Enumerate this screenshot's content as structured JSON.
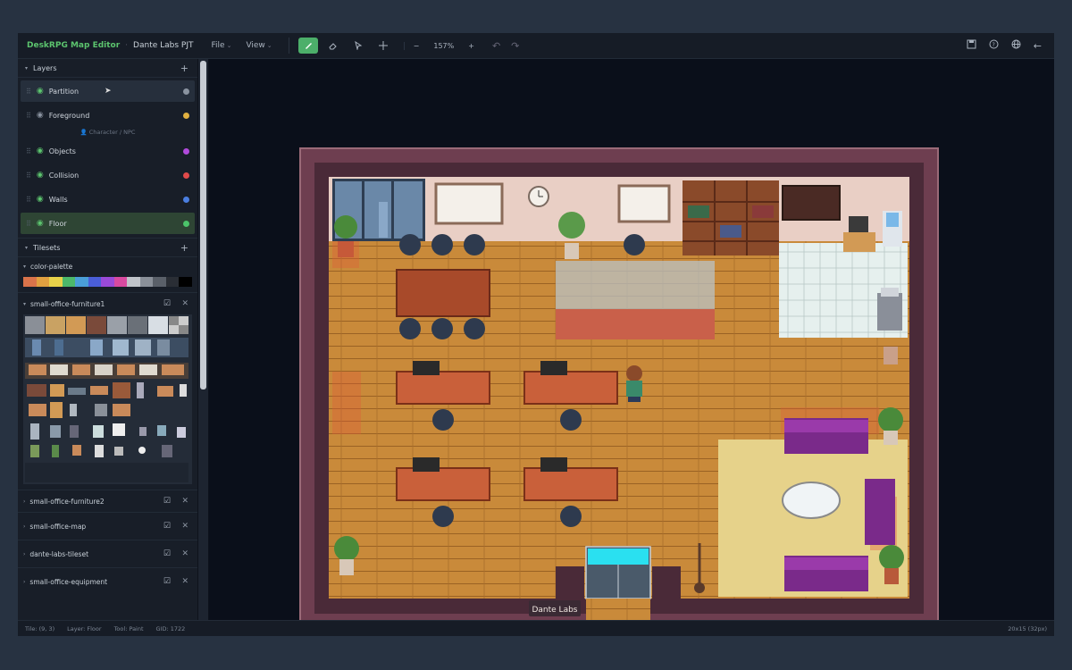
{
  "app": {
    "title": "DeskRPG Map Editor",
    "separator": "·",
    "project": "Dante Labs PJT"
  },
  "menu": {
    "file": "File",
    "view": "View"
  },
  "toolbar": {
    "tools": [
      "paint-brush",
      "eraser",
      "select-arrow",
      "move"
    ],
    "active_tool": "paint-brush",
    "zoom": "157%",
    "zoom_out": "−",
    "zoom_in": "+"
  },
  "layers": {
    "title": "Layers",
    "items": [
      {
        "name": "Partition",
        "color": "#8a93a0"
      },
      {
        "name": "Foreground",
        "color": "#e0b040"
      },
      {
        "name": "Objects",
        "color": "#b04adb"
      },
      {
        "name": "Collision",
        "color": "#e04a4a"
      },
      {
        "name": "Walls",
        "color": "#4a7ee0"
      },
      {
        "name": "Floor",
        "color": "#4cc46a"
      }
    ],
    "note": "Character / NPC"
  },
  "tilesets": {
    "title": "Tilesets",
    "palette_name": "color-palette",
    "palette": [
      "#d9734a",
      "#e0a040",
      "#e8d24a",
      "#4cb86a",
      "#4a9ed8",
      "#4a5ed8",
      "#9a4ad8",
      "#d84aa0",
      "#c0c4ca",
      "#8a9099",
      "#5a6069",
      "#2a2e35",
      "#000000"
    ],
    "items": [
      {
        "name": "small-office-furniture1",
        "expanded": true
      },
      {
        "name": "small-office-furniture2"
      },
      {
        "name": "small-office-map"
      },
      {
        "name": "dante-labs-tileset"
      },
      {
        "name": "small-office-equipment"
      }
    ]
  },
  "map": {
    "entrance_label": "Dante Labs"
  },
  "status": {
    "tile": "Tile: (9, 3)",
    "layer": "Layer: Floor",
    "tool": "Tool: Paint",
    "gid": "GID: 1722",
    "size": "20x15 (32px)"
  }
}
